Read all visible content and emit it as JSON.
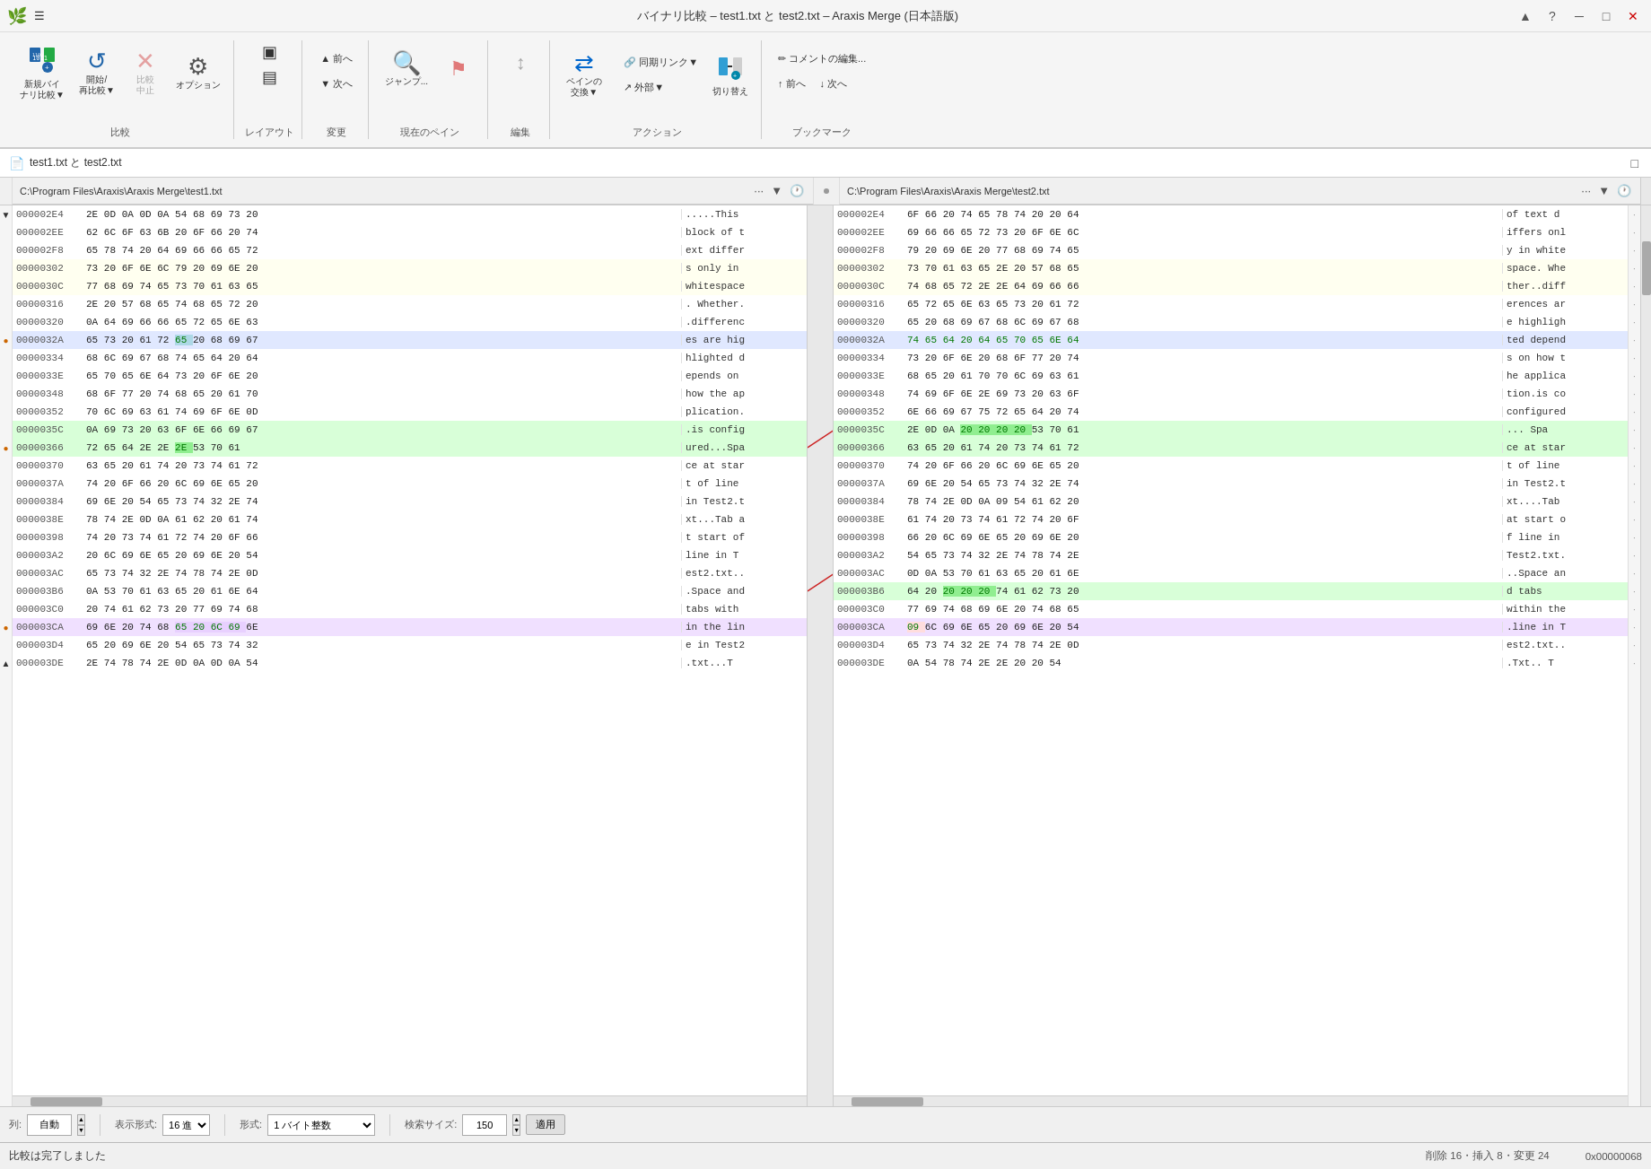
{
  "window": {
    "title": "バイナリ比較 – test1.txt と test2.txt – Araxis Merge (日本語版)",
    "icon": "🌿"
  },
  "titlebar": {
    "controls": [
      "▲",
      "?",
      "─",
      "□",
      "✕"
    ]
  },
  "toolbar": {
    "groups": [
      {
        "label": "比較",
        "buttons": [
          {
            "id": "new-compare",
            "label": "新規バイ\nナリ比較▼",
            "icon": "⊕"
          },
          {
            "id": "start-compare",
            "label": "開始/\n再比較▼",
            "icon": "↺"
          },
          {
            "id": "stop-compare",
            "label": "比較\n中止",
            "icon": "✕"
          },
          {
            "id": "options",
            "label": "オプション",
            "icon": "⚙"
          }
        ]
      },
      {
        "label": "レイアウト",
        "buttons": [
          {
            "id": "layout1",
            "label": "",
            "icon": "⊞"
          },
          {
            "id": "layout2",
            "label": "",
            "icon": "⊟"
          }
        ]
      },
      {
        "label": "変更",
        "buttons": [
          {
            "id": "prev-change",
            "label": "前へ",
            "icon": "◀"
          },
          {
            "id": "next-change",
            "label": "次へ",
            "icon": "▶"
          }
        ]
      },
      {
        "label": "現在のペイン",
        "buttons": [
          {
            "id": "jump",
            "label": "ジャンプ...",
            "icon": "🔍"
          },
          {
            "id": "edit-flag",
            "label": "",
            "icon": "⚑"
          }
        ]
      },
      {
        "label": "編集",
        "buttons": []
      },
      {
        "label": "アクション",
        "buttons": [
          {
            "id": "swap-panes",
            "label": "ペインの\n交換▼",
            "icon": "⇄"
          },
          {
            "id": "sync-link",
            "label": "同期リンク▼",
            "icon": "🔗"
          },
          {
            "id": "external",
            "label": "外部▼",
            "icon": "↗"
          },
          {
            "id": "switch-pane",
            "label": "切り替え",
            "icon": "⊕"
          }
        ]
      },
      {
        "label": "ブックマーク",
        "buttons": [
          {
            "id": "edit-comment",
            "label": "コメントの編集...",
            "icon": "✏"
          },
          {
            "id": "prev-bookmark",
            "label": "前へ",
            "icon": "◀"
          },
          {
            "id": "next-bookmark",
            "label": "次へ",
            "icon": "▶"
          }
        ]
      }
    ]
  },
  "breadcrumb": {
    "icon": "📄",
    "text": "test1.txt と test2.txt"
  },
  "left_pane": {
    "path": "C:\\Program Files\\Araxis\\Araxis Merge\\test1.txt",
    "rows": [
      {
        "addr": "000002E4",
        "bytes": "2E 0D 0A 0D 0A 54 68 69 73 20",
        "text": ".....This ",
        "indicator": "▼",
        "class": ""
      },
      {
        "addr": "000002EE",
        "bytes": "62 6C 6F 63 6B 20 6F 66 20 74",
        "text": "block of t",
        "indicator": "",
        "class": ""
      },
      {
        "addr": "000002F8",
        "bytes": "65 78 74 20 64 69 66 66 65 72",
        "text": "ext differ",
        "indicator": "",
        "class": ""
      },
      {
        "addr": "00000302",
        "bytes": "73 20 6F 6E 6C 79 20 69 6E 20",
        "text": "s only in ",
        "indicator": "",
        "class": "diff-line-yellow"
      },
      {
        "addr": "0000030C",
        "bytes": "77 68 69 74 65 73 70 61 63 65",
        "text": "whitespace",
        "indicator": "",
        "class": "diff-line-yellow"
      },
      {
        "addr": "00000316",
        "bytes": "2E 20 57 68 65 74 68 65 72 20",
        "text": ". Whether.",
        "indicator": "",
        "class": ""
      },
      {
        "addr": "00000320",
        "bytes": "0A 64 69 66 66 65 72 65 6E 63",
        "text": ".differenc",
        "indicator": "",
        "class": ""
      },
      {
        "addr": "0000032A",
        "bytes": "65 73 20 61 72 65 20 68 69 67",
        "text": "es are hig",
        "indicator": "●",
        "class": "diff-line-blue"
      },
      {
        "addr": "00000334",
        "bytes": "68 6C 69 67 68 74 65 64 20 64",
        "text": "hlighted d",
        "indicator": "",
        "class": ""
      },
      {
        "addr": "0000033E",
        "bytes": "65 70 65 6E 64 73 20 6F 6E 20",
        "text": "epends on ",
        "indicator": "",
        "class": ""
      },
      {
        "addr": "00000348",
        "bytes": "68 6F 77 20 74 68 65 20 61 70",
        "text": "how the ap",
        "indicator": "",
        "class": ""
      },
      {
        "addr": "00000352",
        "bytes": "70 6C 69 63 61 74 69 6F 6E 0D",
        "text": "plication.",
        "indicator": "",
        "class": ""
      },
      {
        "addr": "0000035C",
        "bytes": "0A 69 73 20 63 6F 6E 66 69 67",
        "text": ".is config",
        "indicator": "",
        "class": "diff-line-green"
      },
      {
        "addr": "00000366",
        "bytes": "72 65 64 2E 2E 2E 53 70 61",
        "text": "ured...Spa",
        "indicator": "●",
        "class": "diff-line-green"
      },
      {
        "addr": "00000370",
        "bytes": "63 65 20 61 74 20 73 74 61 72",
        "text": "ce at star",
        "indicator": "",
        "class": ""
      },
      {
        "addr": "0000037A",
        "bytes": "74 20 6F 66 20 6C 69 6E 65 20",
        "text": "t of line ",
        "indicator": "",
        "class": ""
      },
      {
        "addr": "00000384",
        "bytes": "69 6E 20 54 65 73 74 32 2E 74",
        "text": "in Test2.t",
        "indicator": "",
        "class": ""
      },
      {
        "addr": "0000038E",
        "bytes": "78 74 2E 0D 0A 61 62 20 61 74",
        "text": "xt...Tab a",
        "indicator": "",
        "class": ""
      },
      {
        "addr": "00000398",
        "bytes": "74 20 73 74 61 72 74 20 6F 66",
        "text": "t start of",
        "indicator": "",
        "class": ""
      },
      {
        "addr": "000003A2",
        "bytes": "20 6C 69 6E 65 20 69 6E 20 54",
        "text": " line in T",
        "indicator": "",
        "class": ""
      },
      {
        "addr": "000003AC",
        "bytes": "65 73 74 32 2E 74 78 74 2E 0D",
        "text": "est2.txt..",
        "indicator": "",
        "class": ""
      },
      {
        "addr": "000003B6",
        "bytes": "0A 53 70 61 63 65 20 61 6E 64",
        "text": ".Space and",
        "indicator": "",
        "class": ""
      },
      {
        "addr": "000003C0",
        "bytes": "20 74 61 62 73 20 77 69 74 68",
        "text": " tabs with",
        "indicator": "",
        "class": ""
      },
      {
        "addr": "000003CA",
        "bytes": "69 6E 20 74 68 65 20 6C 69 6E",
        "text": "in the lin",
        "indicator": "●",
        "class": "diff-line-purple"
      },
      {
        "addr": "000003D4",
        "bytes": "65 20 69 6E 20 54 65 73 74 32",
        "text": "e in Test2",
        "indicator": "",
        "class": ""
      },
      {
        "addr": "000003DE",
        "bytes": "2E 74 78 74 2E 0D 0A 0D 0A 54",
        "text": ".txt...T",
        "indicator": "▲",
        "class": ""
      }
    ]
  },
  "right_pane": {
    "path": "C:\\Program Files\\Araxis\\Araxis Merge\\test2.txt",
    "rows": [
      {
        "addr": "000002E4",
        "bytes": "6F 66 20 74 65 78 74 20 20 64",
        "text": "of text  d",
        "indicator": "",
        "class": ""
      },
      {
        "addr": "000002EE",
        "bytes": "69 66 66 65 72 73 20 6F 6E 6C",
        "text": "iffers onl",
        "indicator": "",
        "class": ""
      },
      {
        "addr": "000002F8",
        "bytes": "79 20 69 6E 20 77 68 69 74 65",
        "text": "y in white",
        "indicator": "",
        "class": ""
      },
      {
        "addr": "00000302",
        "bytes": "73 70 61 63 65 2E 20 57 68 65",
        "text": "space. Whe",
        "indicator": "",
        "class": "diff-line-yellow"
      },
      {
        "addr": "0000030C",
        "bytes": "74 68 65 72 2E 2E 64 69 66 66",
        "text": "ther..diff",
        "indicator": "",
        "class": "diff-line-yellow"
      },
      {
        "addr": "00000316",
        "bytes": "65 72 65 6E 63 65 73 20 61 72",
        "text": "erences ar",
        "indicator": "",
        "class": ""
      },
      {
        "addr": "00000320",
        "bytes": "65 20 68 69 67 68 6C 69 67 68",
        "text": "e highligh",
        "indicator": "",
        "class": ""
      },
      {
        "addr": "0000032A",
        "bytes": "74 65 64 20 64 65 70 65 6E 64",
        "text": "ted depend",
        "indicator": "",
        "class": "diff-line-blue"
      },
      {
        "addr": "00000334",
        "bytes": "73 20 6F 6E 20 68 6F 77 20 74",
        "text": "s on how t",
        "indicator": "",
        "class": ""
      },
      {
        "addr": "0000033E",
        "bytes": "68 65 20 61 70 70 6C 69 63 61",
        "text": "he applica",
        "indicator": "",
        "class": ""
      },
      {
        "addr": "00000348",
        "bytes": "74 69 6F 6E 2E 69 73 20 63 6F",
        "text": "tion.is co",
        "indicator": "",
        "class": ""
      },
      {
        "addr": "00000352",
        "bytes": "6E 66 69 67 75 72 65 64 20 74",
        "text": "configured",
        "indicator": "",
        "class": ""
      },
      {
        "addr": "0000035C",
        "bytes": "2E 0D 0A 20 20 20 20 53 70 61",
        "text": "...    Spa",
        "indicator": "",
        "class": "diff-line-green"
      },
      {
        "addr": "00000366",
        "bytes": "63 65 20 61 74 20 73 74 61 72",
        "text": "ce at star",
        "indicator": "",
        "class": "diff-line-green"
      },
      {
        "addr": "00000370",
        "bytes": "74 20 6F 66 20 6C 69 6E 65 20",
        "text": "t of line ",
        "indicator": "",
        "class": ""
      },
      {
        "addr": "0000037A",
        "bytes": "69 6E 20 54 65 73 74 32 2E 74",
        "text": "in Test2.t",
        "indicator": "",
        "class": ""
      },
      {
        "addr": "00000384",
        "bytes": "78 74 2E 0D 0A 09 54 61 62 20",
        "text": "xt....Tab ",
        "indicator": "",
        "class": ""
      },
      {
        "addr": "0000038E",
        "bytes": "61 74 20 73 74 61 72 74 20 6F",
        "text": "at start o",
        "indicator": "",
        "class": ""
      },
      {
        "addr": "00000398",
        "bytes": "66 20 6C 69 6E 65 20 69 6E 20",
        "text": "f line in ",
        "indicator": "",
        "class": ""
      },
      {
        "addr": "000003A2",
        "bytes": "54 65 73 74 32 2E 74 78 74 2E",
        "text": "Test2.txt.",
        "indicator": "",
        "class": ""
      },
      {
        "addr": "000003AC",
        "bytes": "0D 0A 53 70 61 63 65 20 61 6E",
        "text": "..Space an",
        "indicator": "",
        "class": ""
      },
      {
        "addr": "000003B6",
        "bytes": "64 20 20 20 20 74 61 62 73 20",
        "text": "d    tabs ",
        "indicator": "",
        "class": "diff-line-green"
      },
      {
        "addr": "000003C0",
        "bytes": "77 69 74 68 69 6E 20 74 68 65",
        "text": "within the",
        "indicator": "",
        "class": ""
      },
      {
        "addr": "000003CA",
        "bytes": "09 6C 69 6E 65 20 69 6E 20 54",
        "text": ".line in T",
        "indicator": "",
        "class": "diff-line-purple"
      },
      {
        "addr": "000003D4",
        "bytes": "65 73 74 32 2E 74 78 74 2E 0D",
        "text": "est2.txt..",
        "indicator": "",
        "class": ""
      },
      {
        "addr": "000003DE",
        "bytes": "0A 54 78 74 2E 2E 20 20 54",
        "text": ".Txt.. T",
        "indicator": "",
        "class": ""
      }
    ]
  },
  "status_bar": {
    "column_label": "列:",
    "column_value": "自動",
    "format_label": "表示形式:",
    "format_value": "16 進",
    "type_label": "形式:",
    "type_value": "1 バイト整数",
    "search_size_label": "検索サイズ:",
    "search_size_value": "150",
    "apply_label": "適用"
  },
  "footer": {
    "status": "比較は完了しました",
    "info": "削除 16・挿入 8・変更 24",
    "address": "0x00000068"
  }
}
